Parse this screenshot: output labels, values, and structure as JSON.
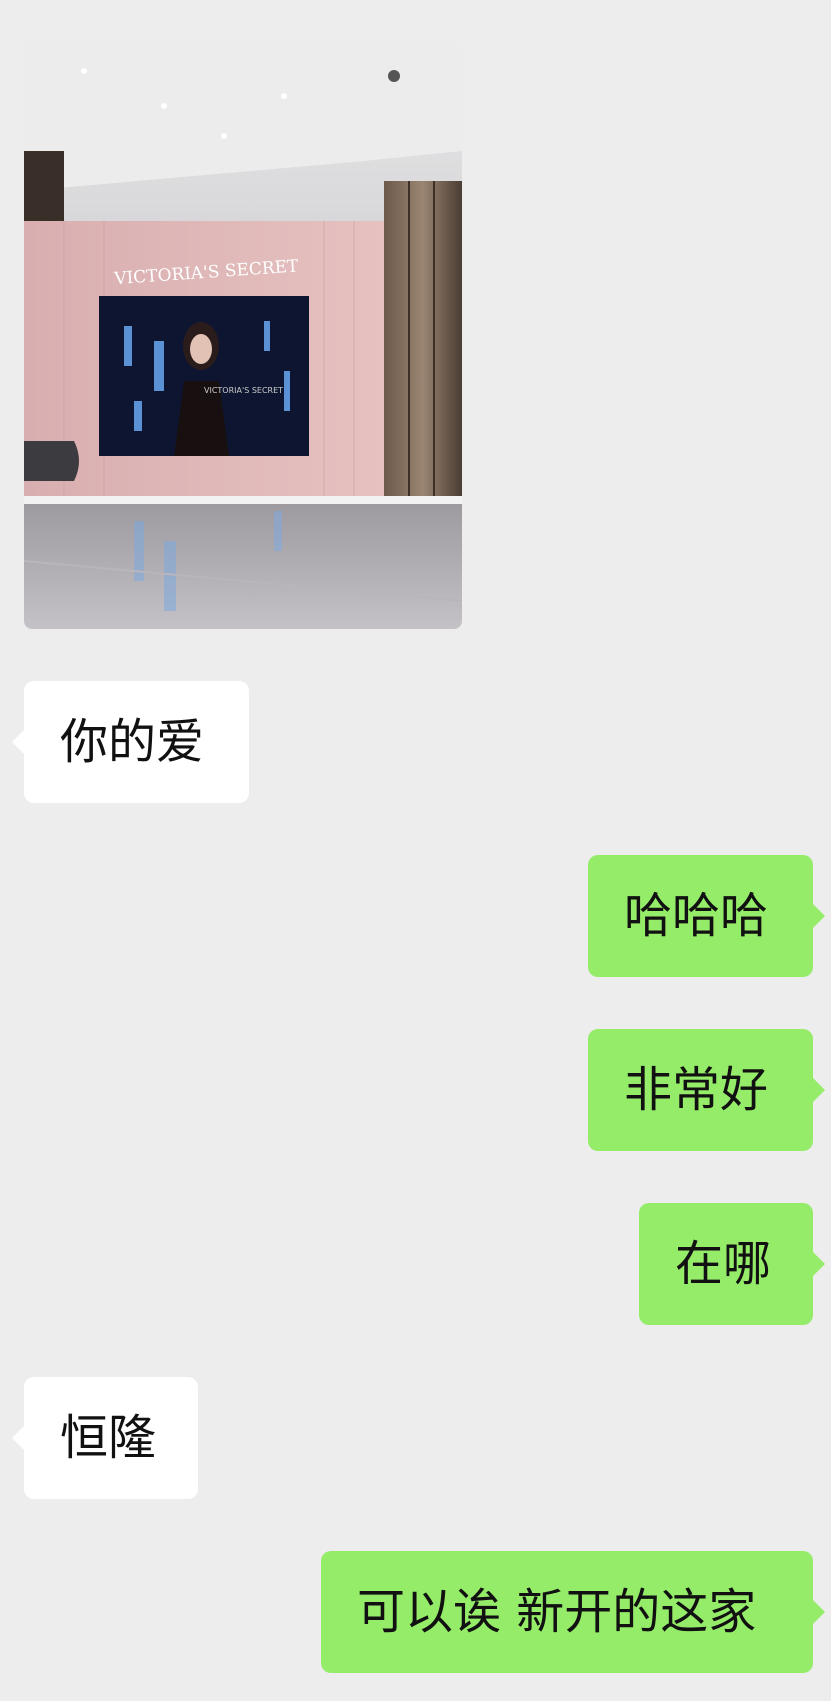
{
  "chat": {
    "photo": {
      "description_icon": "photo-message",
      "storefront_sign": "VICTORIA'S SECRET",
      "screen_text": "VICTORIA'S SECRET"
    },
    "messages": [
      {
        "side": "in",
        "text": "你的爱"
      },
      {
        "side": "out",
        "text": "哈哈哈"
      },
      {
        "side": "out",
        "text": "非常好"
      },
      {
        "side": "out",
        "text": "在哪"
      },
      {
        "side": "in",
        "text": "恒隆"
      },
      {
        "side": "out",
        "text": "可以诶 新开的这家"
      }
    ]
  },
  "colors": {
    "background": "#ededed",
    "incoming_bubble": "#ffffff",
    "outgoing_bubble": "#95ec69"
  }
}
